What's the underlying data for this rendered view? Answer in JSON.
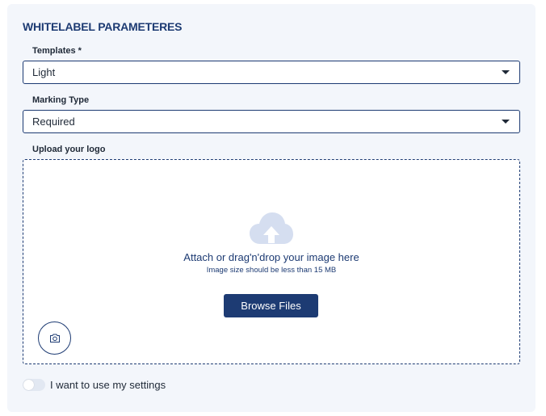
{
  "section": {
    "title": "WHITELABEL PARAMETERES"
  },
  "templates": {
    "label": "Templates *",
    "value": "Light"
  },
  "marking_type": {
    "label": "Marking Type",
    "value": "Required"
  },
  "upload": {
    "label": "Upload your logo",
    "title": "Attach or drag'n'drop your image here",
    "subtitle": "Image size should be less than 15 MB",
    "browse_label": "Browse Files",
    "cloud_icon": "cloud-upload-icon",
    "camera_icon": "camera-icon"
  },
  "settings_toggle": {
    "label": "I want to use my settings",
    "checked": false
  },
  "colors": {
    "accent": "#1d3b73",
    "panel_bg": "#f3f6fb",
    "cloud": "#d5def0"
  }
}
